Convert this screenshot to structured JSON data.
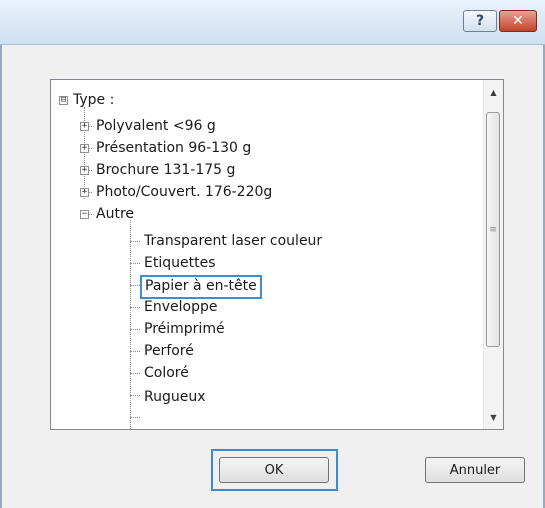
{
  "titlebar": {
    "help_label": "?",
    "close_label": "✕"
  },
  "tree": {
    "items": [
      {
        "label": "Type :",
        "toggle": "⊟"
      },
      {
        "label": "Polyvalent <96 g",
        "toggle": "+"
      },
      {
        "label": "Présentation 96-130 g",
        "toggle": "+"
      },
      {
        "label": "Brochure 131-175 g",
        "toggle": "+"
      },
      {
        "label": "Photo/Couvert. 176-220g",
        "toggle": "+"
      },
      {
        "label": "Autre",
        "toggle": "−"
      },
      {
        "label": "Transparent laser couleur"
      },
      {
        "label": "Etiquettes"
      },
      {
        "label": "Papier à en-tête",
        "selected": true
      },
      {
        "label": "Enveloppe"
      },
      {
        "label": "Préimprimé"
      },
      {
        "label": "Perforé"
      },
      {
        "label": "Coloré"
      },
      {
        "label": "Rugueux"
      }
    ],
    "scroll_up": "▲",
    "scroll_down": "▼",
    "grip": "≡"
  },
  "buttons": {
    "ok_label": "OK",
    "cancel_label": "Annuler"
  },
  "colors": {
    "selection_border": "#3a8ed6",
    "close_button": "#c3442c"
  }
}
